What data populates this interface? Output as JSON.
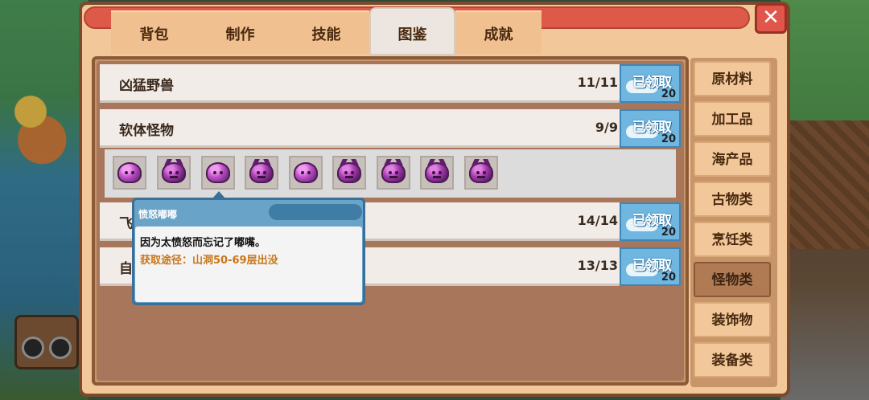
{
  "tabs": [
    {
      "label": "背包"
    },
    {
      "label": "制作"
    },
    {
      "label": "技能"
    },
    {
      "label": "图鉴",
      "active": true
    },
    {
      "label": "成就"
    }
  ],
  "close_label": "✕",
  "rows": [
    {
      "name": "凶猛野兽",
      "count": "11/11",
      "reward_label": "已领取",
      "reward_amount": "20"
    },
    {
      "name": "软体怪物",
      "count": "9/9",
      "reward_label": "已领取",
      "reward_amount": "20"
    },
    {
      "name": "飞",
      "count": "14/14",
      "reward_label": "已领取",
      "reward_amount": "20"
    },
    {
      "name": "自",
      "count": "13/13",
      "reward_label": "已领取",
      "reward_amount": "20"
    }
  ],
  "monster_icons": [
    "slime",
    "angry-slime",
    "slime",
    "angry-slime",
    "slime",
    "angry-slime",
    "angry-slime",
    "angry-slime",
    "angry-slime"
  ],
  "tooltip": {
    "title": "愤怒嘟嘟",
    "description": "因为太愤怒而忘记了嘟嘴。",
    "source": "获取途径：山洞50-69层出没"
  },
  "categories": [
    {
      "label": "原材料"
    },
    {
      "label": "加工品"
    },
    {
      "label": "海产品"
    },
    {
      "label": "古物类"
    },
    {
      "label": "烹饪类"
    },
    {
      "label": "怪物类",
      "active": true
    },
    {
      "label": "装饰物"
    },
    {
      "label": "装备类"
    }
  ],
  "colors": {
    "frame": "#f2c89a",
    "accent_red": "#de5a48",
    "badge_blue": "#6fb6e0",
    "source_text": "#c8761a"
  }
}
